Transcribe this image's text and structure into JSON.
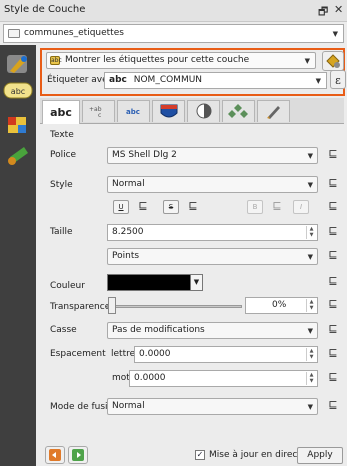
{
  "window": {
    "title": "Style de Couche",
    "float_icon": "🗗",
    "close_icon": "✕"
  },
  "layer": {
    "name": "communes_etiquettes"
  },
  "labeling": {
    "show_labels_text": "Montrer les étiquettes pour cette couche",
    "label_with_text": "Étiqueter avec",
    "field_prefix": "abc",
    "field_value": "NOM_COMMUN"
  },
  "tabs": [
    {
      "label": "abc",
      "icon": "text-tab-icon"
    },
    {
      "label": "+ab c",
      "icon": "formatting-tab-icon"
    },
    {
      "label": "abc",
      "icon": "buffer-tab-icon"
    },
    {
      "label": "",
      "icon": "background-tab-icon"
    },
    {
      "label": "",
      "icon": "shadow-tab-icon"
    },
    {
      "label": "",
      "icon": "placement-tab-icon"
    },
    {
      "label": "",
      "icon": "rendering-tab-icon"
    }
  ],
  "text": {
    "section_title": "Texte",
    "police_label": "Police",
    "police_value": "MS Shell Dlg 2",
    "style_label": "Style",
    "style_value": "Normal",
    "style_buttons": [
      "U",
      "S",
      "B",
      "I"
    ],
    "taille_label": "Taille",
    "taille_value": "8.2500",
    "unit_value": "Points",
    "couleur_label": "Couleur",
    "transparence_label": "Transparence",
    "transparence_value": "0%",
    "transparence_fraction": 0,
    "casse_label": "Casse",
    "casse_value": "Pas de modifications",
    "espacement_label": "Espacement",
    "lettre_label": "lettre",
    "lettre_value": "0.0000",
    "mot_label": "mot",
    "mot_value": "0.0000",
    "fusion_label": "Mode de fusion",
    "fusion_value": "Normal"
  },
  "bottom": {
    "live_update_label": "Mise à jour en direct",
    "live_update_checked": true,
    "apply_label": "Apply"
  },
  "colors": {
    "accent_red": "#e85c16",
    "sidebar": "#3f3f3f",
    "label_color": "#000000"
  }
}
